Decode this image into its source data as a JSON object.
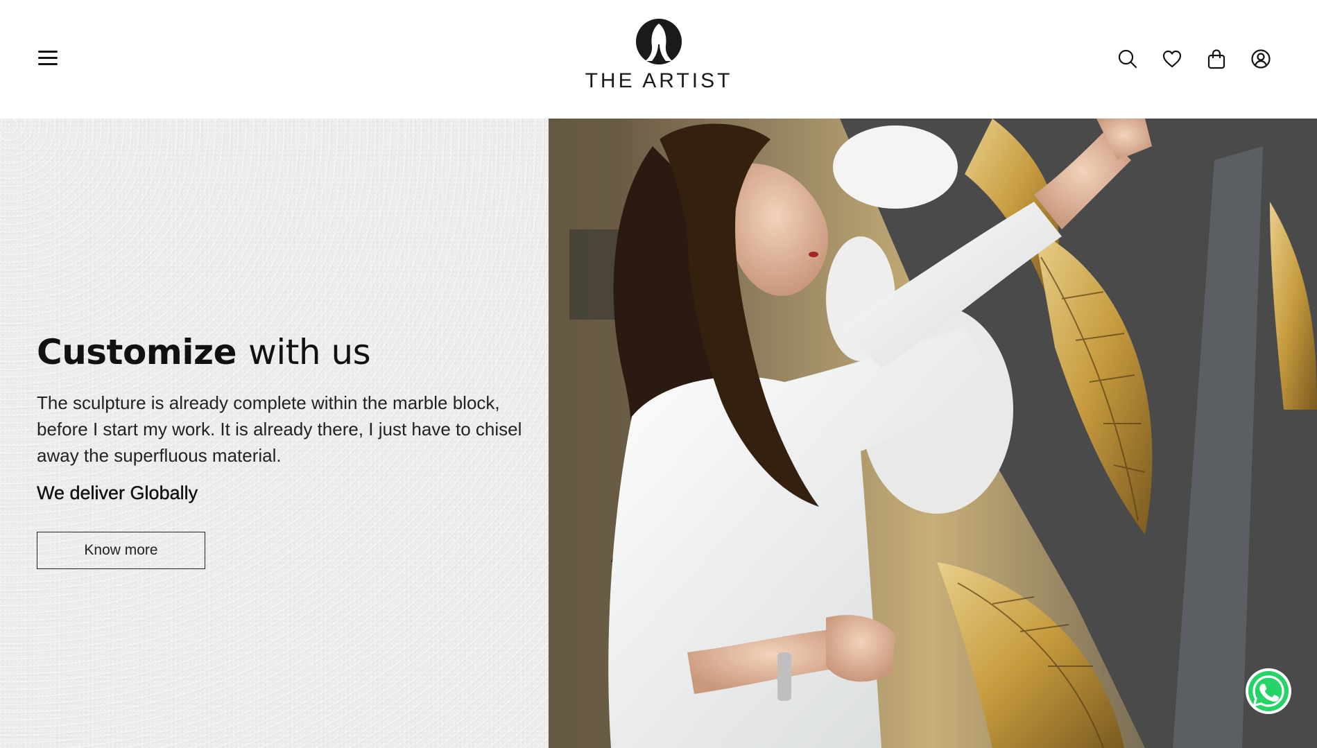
{
  "header": {
    "logo_text": "THE ARTIST",
    "menu_icon": "hamburger-menu-icon",
    "icons": [
      "search-icon",
      "heart-icon",
      "shopping-bag-icon",
      "user-account-icon"
    ]
  },
  "hero": {
    "title_bold": "Customize",
    "title_light": "with us",
    "description": "The sculpture is already complete within the marble block, before I start my work. It is already there, I just have to chisel away the superfluous material.",
    "delivery": "We deliver Globally",
    "cta_label": "Know more"
  },
  "floating": {
    "whatsapp_icon": "whatsapp-icon"
  },
  "colors": {
    "text": "#111111",
    "left_panel_bg": "#ececec",
    "gold": "#c9a24a",
    "whatsapp_green": "#25d366"
  }
}
